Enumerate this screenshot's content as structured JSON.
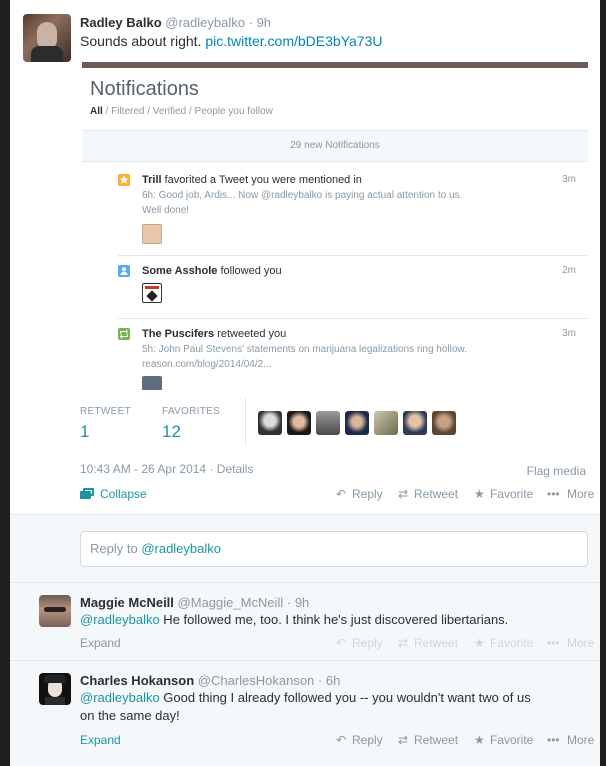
{
  "main_tweet": {
    "fullname": "Radley Balko",
    "handle": "@radleybalko",
    "separator": "·",
    "time": "9h",
    "text": "Sounds about right.",
    "link": "pic.twitter.com/bDE3bYa73U",
    "embedded": {
      "title": "Notifications",
      "tab_all": "All",
      "tabs_rest": " / Filtered / Verified / People you follow",
      "new_bar": "29 new Notifications",
      "items": [
        {
          "name": "Trill",
          "action": " favorited a Tweet you were mentioned in",
          "time": "3m",
          "line1": "6h: Good job, Ardis... Now @radleybalko is paying actual attention to us.",
          "line2": "Well done!",
          "icon": "star-icon",
          "icon_color": "#ffac33"
        },
        {
          "name": "Some Asshole",
          "action": " followed you",
          "time": "2m",
          "line1": "",
          "line2": "",
          "icon": "person-icon",
          "icon_color": "#55acee"
        },
        {
          "name": "The Puscifers",
          "action": " retweeted you",
          "time": "3m",
          "line1": "5h: John Paul Stevens' statements on marijuana legalizations ring hollow.",
          "line2": "reason.com/blog/2014/04/2...",
          "icon": "retweet-icon",
          "icon_color": "#77b255"
        }
      ]
    },
    "stats": {
      "retweet_label": "RETWEET",
      "retweet_count": "1",
      "favorites_label": "FAVORITES",
      "favorites_count": "12"
    },
    "timestamp": "10:43 AM - 26 Apr 2014",
    "details": "Details",
    "flag": "Flag media",
    "collapse": "Collapse"
  },
  "actions": {
    "reply": "Reply",
    "retweet": "Retweet",
    "favorite": "Favorite",
    "more": "More",
    "expand": "Expand"
  },
  "reply_box": {
    "prefix": "Reply to ",
    "handle": "@radleybalko"
  },
  "replies": [
    {
      "fullname": "Maggie McNeill",
      "handle": "@Maggie_McNeill",
      "time": "9h",
      "mention": "@radleybalko",
      "text": " He followed me, too.  I think he's just discovered libertarians."
    },
    {
      "fullname": "Charles Hokanson",
      "handle": "@CharlesHokanson",
      "time": "6h",
      "mention": "@radleybalko",
      "text": " Good thing I already followed you -- you wouldn't want two of us",
      "text2": "on the same day!"
    }
  ],
  "colors": {
    "accent": "#1b95a0",
    "link": "#0084b4",
    "muted": "#8899a6"
  }
}
